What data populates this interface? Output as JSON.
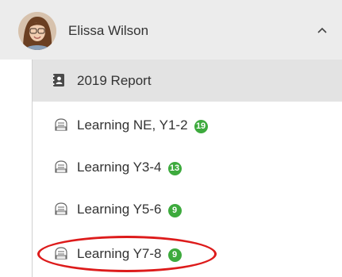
{
  "user": {
    "name": "Elissa Wilson",
    "avatar_icon": "user-photo-avatar"
  },
  "header": {
    "toggle_icon": "chevron-up-icon"
  },
  "report": {
    "label": "2019 Report",
    "icon": "report-book-icon"
  },
  "groups": [
    {
      "label": "Learning NE, Y1-2",
      "count": "19",
      "icon": "group-bag-icon"
    },
    {
      "label": "Learning Y3-4",
      "count": "13",
      "icon": "group-bag-icon"
    },
    {
      "label": "Learning Y5-6",
      "count": "9",
      "icon": "group-bag-icon"
    },
    {
      "label": "Learning Y7-8",
      "count": "9",
      "icon": "group-bag-icon",
      "highlighted": true
    }
  ],
  "colors": {
    "header_bg": "#ececec",
    "selected_bg": "#e3e3e3",
    "badge": "#3daa3d",
    "highlight": "#dd1b1b",
    "text": "#333333"
  }
}
